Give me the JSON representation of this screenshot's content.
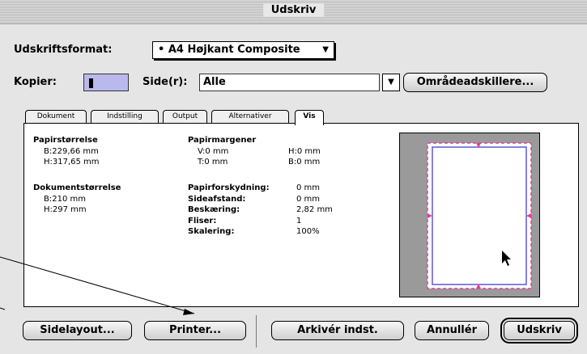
{
  "window": {
    "title": "Udskriv"
  },
  "format": {
    "label": "Udskriftsformat:",
    "value": "• A4 Højkant Composite"
  },
  "copies": {
    "label": "Kopier:",
    "value": "1"
  },
  "pages": {
    "label": "Side(r):",
    "value": "Alle"
  },
  "range_button": "Områdeadskillere...",
  "tabs": [
    "Dokument",
    "Indstilling",
    "Output",
    "Alternativer",
    "Vis"
  ],
  "info": {
    "paper_size": {
      "title": "Papirstørrelse",
      "w": "B:229,66 mm",
      "h": "H:317,65 mm"
    },
    "paper_margins": {
      "title": "Papirmargener",
      "v": "V:0 mm",
      "h": "H:0 mm",
      "t": "T:0 mm",
      "b": "B:0 mm"
    },
    "doc_size": {
      "title": "Dokumentstørrelse",
      "w": "B:210 mm",
      "h": "H:297 mm"
    },
    "rows": [
      {
        "label": "Papirforskydning:",
        "value": "0 mm"
      },
      {
        "label": "Sideafstand:",
        "value": "0 mm"
      },
      {
        "label": "Beskæring:",
        "value": "2,82 mm"
      },
      {
        "label": "Fliser:",
        "value": "1"
      },
      {
        "label": "Skalering:",
        "value": "100%"
      }
    ]
  },
  "buttons": {
    "page_setup": "Sidelayout...",
    "printer": "Printer...",
    "save": "Arkivér indst.",
    "cancel": "Annullér",
    "print": "Udskriv"
  },
  "colors": {
    "copies_field": "#b9b9ee",
    "preview_bg": "#9a9a9a",
    "page_border": "#5a5ad6",
    "marks": "#e0409a"
  }
}
